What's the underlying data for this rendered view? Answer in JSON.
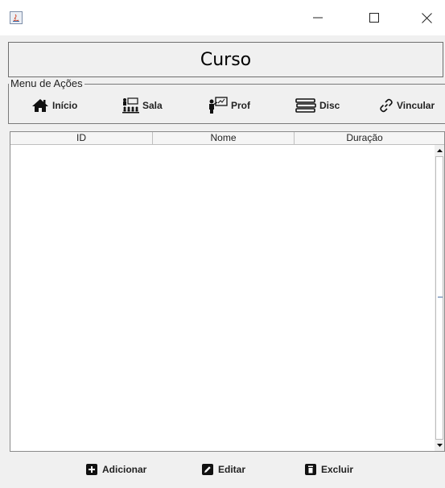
{
  "window": {
    "app_icon": "java-icon",
    "controls": [
      "minimize-icon",
      "maximize-icon",
      "close-icon"
    ]
  },
  "header": {
    "title": "Curso"
  },
  "menu": {
    "legend": "Menu de Ações",
    "items": [
      {
        "label": "Início",
        "icon": "home-icon"
      },
      {
        "label": "Sala",
        "icon": "classroom-icon"
      },
      {
        "label": "Prof",
        "icon": "teacher-icon"
      },
      {
        "label": "Disc",
        "icon": "books-icon"
      },
      {
        "label": "Vincular",
        "icon": "link-icon"
      }
    ]
  },
  "table": {
    "columns": [
      "ID",
      "Nome",
      "Duração"
    ],
    "rows": []
  },
  "actions": {
    "add_label": "Adicionar",
    "edit_label": "Editar",
    "delete_label": "Excluir"
  }
}
